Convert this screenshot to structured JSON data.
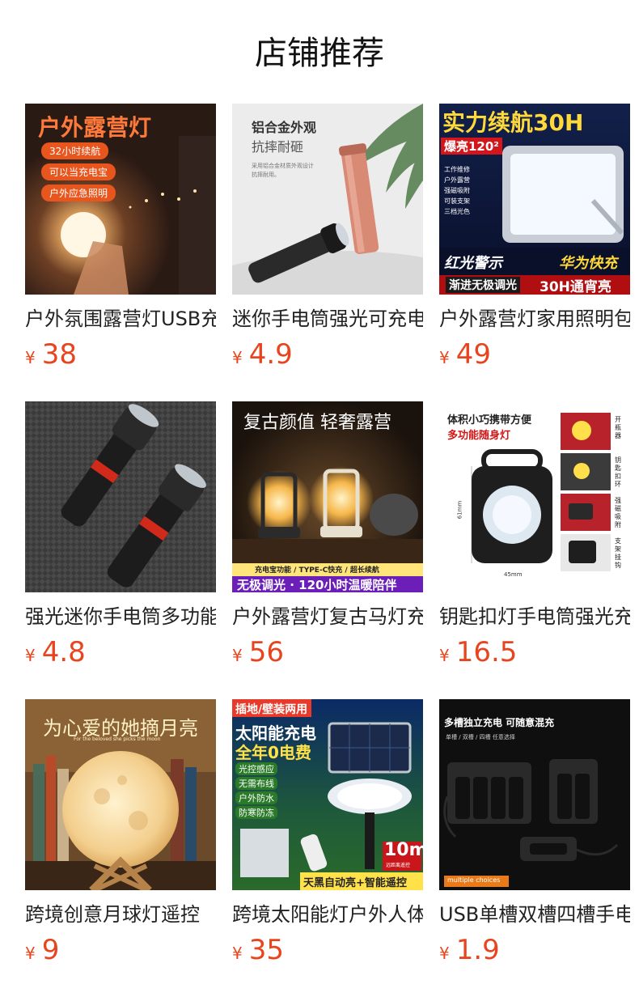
{
  "header": {
    "title": "店铺推荐"
  },
  "products": [
    {
      "title": "户外氛围露营灯USB充电",
      "price": "38",
      "currency": "¥",
      "image_text": {
        "headline": "户外露营灯",
        "tags": [
          "32小时续航",
          "可以当充电宝",
          "户外应急照明"
        ]
      }
    },
    {
      "title": "迷你手电筒强光可充电",
      "price": "4.9",
      "currency": "¥",
      "image_text": {
        "headline": "铝合金外观",
        "sub": "抗摔耐砸",
        "note1": "采用铝合金材质外观设计",
        "note2": "抗摔耐用。"
      }
    },
    {
      "title": "户外露营灯家用照明包邮",
      "price": "49",
      "currency": "¥",
      "image_text": {
        "headline": "实力续航30H",
        "badge": "爆亮120²",
        "features": [
          "工作维修",
          "户外露营",
          "强磁吸附",
          "可装支架",
          "三档光色"
        ],
        "left_tag": "红光警示",
        "right_tag": "华为快充",
        "footer_left": "渐进无极调光",
        "footer_right": "30H通宵亮"
      }
    },
    {
      "title": "强光迷你手电筒多功能",
      "price": "4.8",
      "currency": "¥",
      "image_text": {}
    },
    {
      "title": "户外露营灯复古马灯充电",
      "price": "56",
      "currency": "¥",
      "image_text": {
        "headline": "复古颜值 轻奢露营",
        "strip": "充电宝功能 / TYPE-C快充 / 超长续航",
        "footer": "无极调光 · 120小时温暖陪伴"
      }
    },
    {
      "title": "钥匙扣灯手电筒强光充电",
      "price": "16.5",
      "currency": "¥",
      "image_text": {
        "headline1": "体积小巧携带方便",
        "headline2": "多功能随身灯",
        "dim1": "61mm",
        "dim2": "45mm",
        "side": [
          "开瓶器",
          "钥匙扣环",
          "强磁吸附",
          "支架挂钩"
        ]
      }
    },
    {
      "title": "跨境创意月球灯遥控",
      "price": "9",
      "currency": "¥",
      "image_text": {
        "headline": "为心爱的她摘月亮",
        "sub": "For the beloved she picks the moon"
      }
    },
    {
      "title": "跨境太阳能灯户外人体感应",
      "price": "35",
      "currency": "¥",
      "image_text": {
        "top_tag": "插地/壁装两用",
        "headline1": "太阳能充电",
        "headline2": "全年0电费",
        "features": [
          "光控感应",
          "无需布线",
          "户外防水",
          "防寒防冻"
        ],
        "range_value": "10m",
        "range_label": "远距离遥控",
        "footer": "天黑自动亮+智能遥控"
      }
    },
    {
      "title": "USB单槽双槽四槽手电筒充电器",
      "price": "1.9",
      "currency": "¥",
      "image_text": {
        "headline": "多槽独立充电 可随意混充",
        "sub": "单槽 / 双槽 / 四槽 任意选择",
        "footer": "multiple choices"
      }
    }
  ],
  "colors": {
    "price": "#e8451e",
    "title": "#222222"
  }
}
